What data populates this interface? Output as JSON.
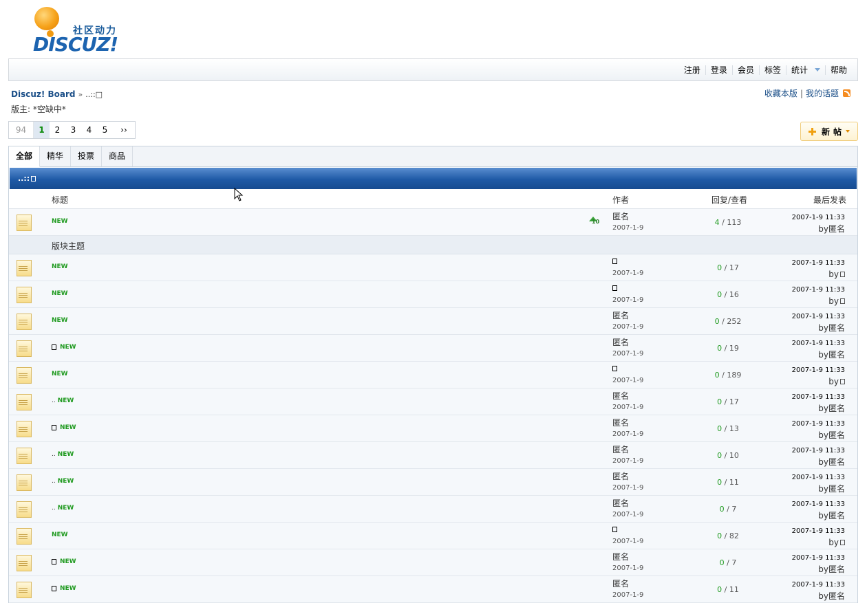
{
  "logo": {
    "cn": "社区动力",
    "en": "DISCUZ!"
  },
  "topnav": {
    "items": [
      "注册",
      "登录",
      "会员",
      "标签",
      "统计",
      "帮助"
    ]
  },
  "breadcrumb": {
    "home": "Discuz! Board",
    "sep": "»",
    "current": "..::□"
  },
  "moderator": "版主: *空缺中*",
  "links": {
    "favorite": "收藏本版",
    "bar": "|",
    "mythreads": "我的话题"
  },
  "pager": {
    "total": "94",
    "pages": [
      "1",
      "2",
      "3",
      "4",
      "5"
    ],
    "next": "››",
    "current": "1"
  },
  "new_button": {
    "label": "新帖"
  },
  "tabs": [
    "全部",
    "精华",
    "投票",
    "商品"
  ],
  "banner": "..::",
  "columns": {
    "title": "标题",
    "author": "作者",
    "counts": "回复/查看",
    "last": "最后发表"
  },
  "section_label": "版块主题",
  "sticky": {
    "new_label": "NEW",
    "author": "匿名",
    "date": "2007-1-9",
    "replies": "4",
    "views": "113",
    "last_time": "2007-1-9 11:33",
    "by": "by",
    "last_author": "匿名"
  },
  "threads": [
    {
      "prefix": "",
      "author": "",
      "author_box": true,
      "date": "2007-1-9",
      "replies": "0",
      "views": "17",
      "last_time": "2007-1-9 11:33",
      "last_author": "",
      "last_box": true
    },
    {
      "prefix": "",
      "author": "",
      "author_box": true,
      "date": "2007-1-9",
      "replies": "0",
      "views": "16",
      "last_time": "2007-1-9 11:33",
      "last_author": "",
      "last_box": true
    },
    {
      "prefix": "",
      "author": "匿名",
      "author_box": false,
      "date": "2007-1-9",
      "replies": "0",
      "views": "252",
      "last_time": "2007-1-9 11:33",
      "last_author": "匿名",
      "last_box": false
    },
    {
      "prefix": "box",
      "author": "匿名",
      "author_box": false,
      "date": "2007-1-9",
      "replies": "0",
      "views": "19",
      "last_time": "2007-1-9 11:33",
      "last_author": "匿名",
      "last_box": false
    },
    {
      "prefix": "",
      "author": "",
      "author_box": true,
      "date": "2007-1-9",
      "replies": "0",
      "views": "189",
      "last_time": "2007-1-9 11:33",
      "last_author": "",
      "last_box": true
    },
    {
      "prefix": "dots",
      "author": "匿名",
      "author_box": false,
      "date": "2007-1-9",
      "replies": "0",
      "views": "17",
      "last_time": "2007-1-9 11:33",
      "last_author": "匿名",
      "last_box": false
    },
    {
      "prefix": "box",
      "author": "匿名",
      "author_box": false,
      "date": "2007-1-9",
      "replies": "0",
      "views": "13",
      "last_time": "2007-1-9 11:33",
      "last_author": "匿名",
      "last_box": false
    },
    {
      "prefix": "dots",
      "author": "匿名",
      "author_box": false,
      "date": "2007-1-9",
      "replies": "0",
      "views": "10",
      "last_time": "2007-1-9 11:33",
      "last_author": "匿名",
      "last_box": false
    },
    {
      "prefix": "dots",
      "author": "匿名",
      "author_box": false,
      "date": "2007-1-9",
      "replies": "0",
      "views": "11",
      "last_time": "2007-1-9 11:33",
      "last_author": "匿名",
      "last_box": false
    },
    {
      "prefix": "dots",
      "author": "匿名",
      "author_box": false,
      "date": "2007-1-9",
      "replies": "0",
      "views": "7",
      "last_time": "2007-1-9 11:33",
      "last_author": "匿名",
      "last_box": false
    },
    {
      "prefix": "",
      "author": "",
      "author_box": true,
      "date": "2007-1-9",
      "replies": "0",
      "views": "82",
      "last_time": "2007-1-9 11:33",
      "last_author": "",
      "last_box": true
    },
    {
      "prefix": "box",
      "author": "匿名",
      "author_box": false,
      "date": "2007-1-9",
      "replies": "0",
      "views": "7",
      "last_time": "2007-1-9 11:33",
      "last_author": "匿名",
      "last_box": false
    },
    {
      "prefix": "box",
      "author": "匿名",
      "author_box": false,
      "date": "2007-1-9",
      "replies": "0",
      "views": "11",
      "last_time": "2007-1-9 11:33",
      "last_author": "匿名",
      "last_box": false
    }
  ],
  "new_label": "NEW",
  "by_label": "by",
  "dots_text": "..",
  "colors": {
    "accent": "#1f5aa6",
    "new": "#1f9a1f",
    "link": "#1b4f88"
  }
}
